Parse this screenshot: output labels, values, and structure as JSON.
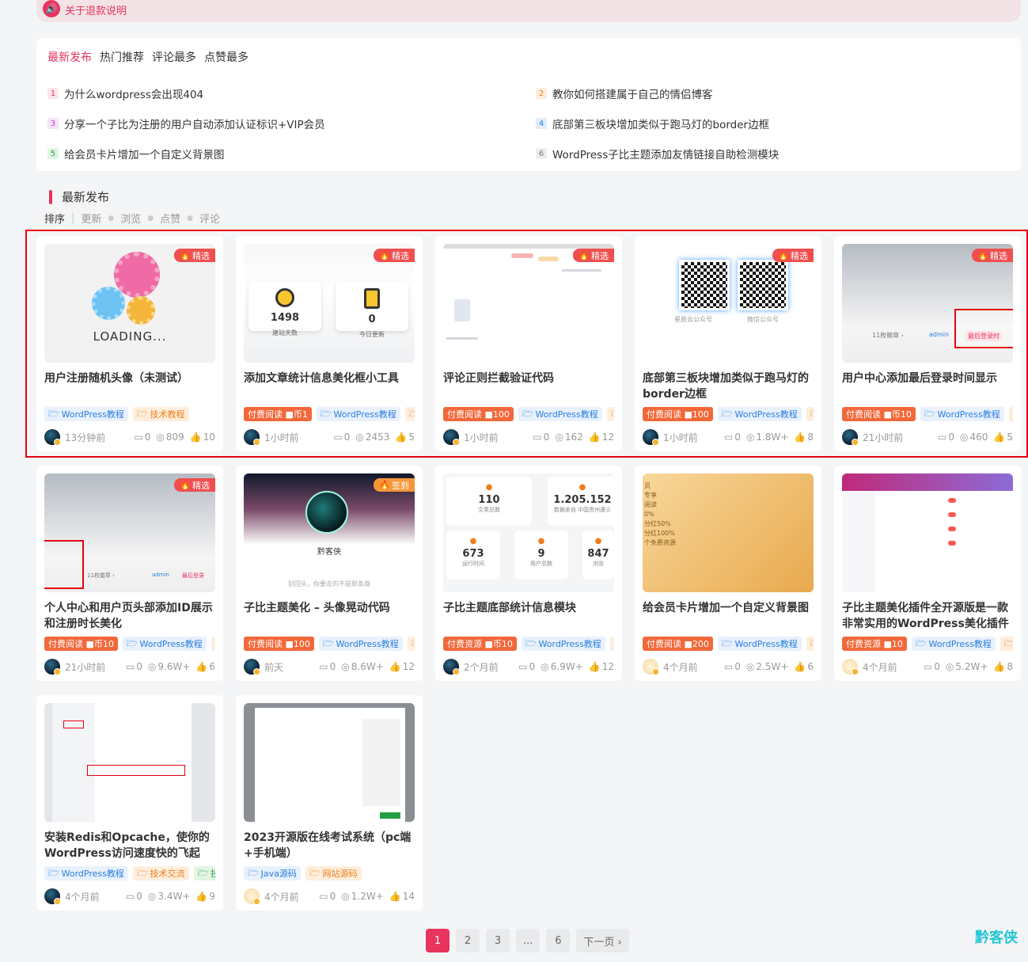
{
  "notice": {
    "text": "关于退款说明",
    "icon": "speaker-icon"
  },
  "tabs": [
    "最新发布",
    "热门推荐",
    "评论最多",
    "点赞最多"
  ],
  "hot_posts": [
    {
      "rank": "1",
      "title": "为什么wordpress会出现404"
    },
    {
      "rank": "2",
      "title": "教你如何搭建属于自己的情侣博客"
    },
    {
      "rank": "3",
      "title": "分享一个子比为注册的用户自动添加认证标识+VIP会员"
    },
    {
      "rank": "4",
      "title": "底部第三板块增加类似于跑马灯的border边框"
    },
    {
      "rank": "5",
      "title": "给会员卡片增加一个自定义背景图"
    },
    {
      "rank": "6",
      "title": "WordPress子比主题添加友情链接自助检测模块"
    }
  ],
  "section": {
    "title": "最新发布",
    "sort_lead": "排序",
    "sorts": [
      "更新",
      "浏览",
      "点赞",
      "评论"
    ]
  },
  "cards": [
    {
      "title": "用户注册随机头像（未测试）",
      "badge": "精选",
      "tags": [
        "WordPress教程",
        "技术教程"
      ],
      "time": "13分钟前",
      "comments": "0",
      "views": "809",
      "likes": "10",
      "thumb_text": "LOADING..."
    },
    {
      "title": "添加文章统计信息美化框小工具",
      "badge": "精选",
      "tags": [
        "付费阅读 ■币1",
        "WordPress教程",
        ""
      ],
      "time": "1小时前",
      "comments": "0",
      "views": "2453",
      "likes": "5",
      "s1": "1498",
      "s1l": "建站天数",
      "s2": "0",
      "s2l": "今日更新"
    },
    {
      "title": "评论正则拦截验证代码",
      "badge": "精选",
      "tags": [
        "付费阅读 ■100",
        "WordPress教程",
        ""
      ],
      "time": "1小时前",
      "comments": "0",
      "views": "162",
      "likes": "12"
    },
    {
      "title": "底部第三板块增加类似于跑马灯的border边框",
      "badge": "精选",
      "tags": [
        "付费阅读 ■100",
        "WordPress教程",
        ""
      ],
      "time": "1小时前",
      "comments": "0",
      "views": "1.8W+",
      "likes": "8",
      "q1": "星辰云公众号",
      "q2": "微信公众号"
    },
    {
      "title": "用户中心添加最后登录时间显示",
      "badge": "精选",
      "tags": [
        "付费阅读 ■币10",
        "WordPress教程",
        ""
      ],
      "time": "21小时前",
      "comments": "0",
      "views": "460",
      "likes": "5",
      "thumb_a": "11枚徽章 ›",
      "thumb_b": "admin",
      "thumb_c": "最后登录时"
    },
    {
      "title": "个人中心和用户页头部添加ID展示和注册时长美化",
      "badge": "精选",
      "tags": [
        "付费阅读 ■币10",
        "WordPress教程",
        ""
      ],
      "time": "21小时前",
      "comments": "0",
      "views": "9.6W+",
      "likes": "6",
      "thumb_a": "11枚徽章 ›",
      "thumb_b": "admin",
      "thumb_c": "最后登录"
    },
    {
      "title": "子比主题美化 – 头像晃动代码",
      "badge": "签到",
      "tags": [
        "付费阅读 ■100",
        "WordPress教程",
        ""
      ],
      "time": "前天",
      "comments": "0",
      "views": "8.6W+",
      "likes": "12",
      "thumb_a": "黔客侠",
      "thumb_b": "别回头，你要走的不是那条路"
    },
    {
      "title": "子比主题底部统计信息模块",
      "badge": "",
      "tags": [
        "付费资源 ■币10",
        "WordPress教程",
        ""
      ],
      "time": "2个月前",
      "comments": "0",
      "views": "6.9W+",
      "likes": "12",
      "st": [
        "110",
        "1.205.152",
        "673",
        "9",
        "847"
      ],
      "stl": [
        "文章总数",
        "数据来自 中国贵州遵义",
        "运行时间",
        "用户总数",
        "浏览"
      ]
    },
    {
      "title": "给会员卡片增加一个自定义背景图",
      "badge": "",
      "tags": [
        "付费阅读 ■200",
        "WordPress教程",
        ""
      ],
      "time": "4个月前",
      "comments": "0",
      "views": "2.5W+",
      "likes": "6",
      "gold": [
        "员",
        "专享",
        "阅读",
        "0%",
        "分红50%",
        "分红100%",
        "个免费资源"
      ]
    },
    {
      "title": "子比主题美化插件全开源版是一款非常实用的WordPress美化插件",
      "badge": "",
      "tags": [
        "付费资源 ■10",
        "WordPress教程",
        ""
      ],
      "time": "4个月前",
      "comments": "0",
      "views": "5.2W+",
      "likes": "8"
    },
    {
      "title": "安装Redis和Opcache，使你的WordPress访问速度快的飞起",
      "badge": "",
      "tags": [
        "WordPress教程",
        "技术交流",
        "技"
      ],
      "time": "4个月前",
      "comments": "0",
      "views": "3.4W+",
      "likes": "9"
    },
    {
      "title": "2023开源版在线考试系统（pc端+手机端）",
      "badge": "",
      "tags": [
        "Java源码",
        "网站源码"
      ],
      "time": "4个月前",
      "comments": "0",
      "views": "1.2W+",
      "likes": "14"
    }
  ],
  "pagination": [
    "1",
    "2",
    "3",
    "...",
    "6",
    "下一页 ›"
  ],
  "logo": "黔客侠"
}
